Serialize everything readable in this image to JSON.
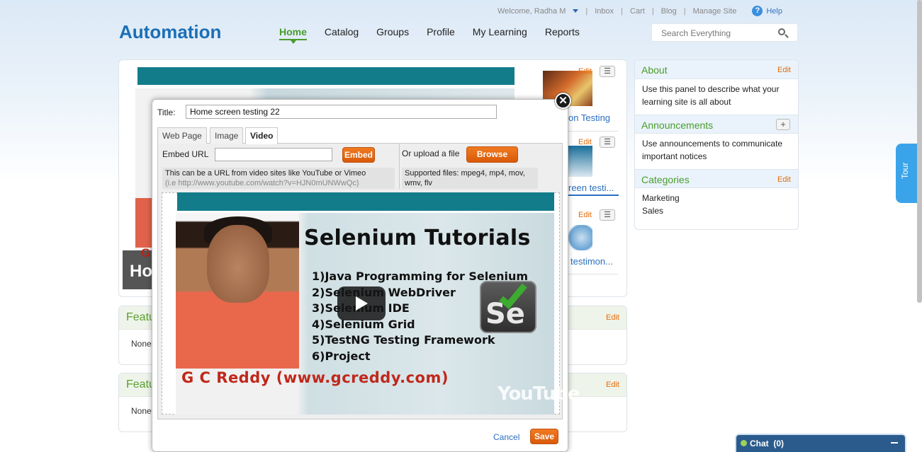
{
  "topbar": {
    "welcome": "Welcome, Radha M",
    "links": [
      "Inbox",
      "Cart",
      "Blog",
      "Manage Site"
    ],
    "help": "Help",
    "help_icon": "question-icon"
  },
  "brand": "Automation",
  "nav": {
    "items": [
      "Home",
      "Catalog",
      "Groups",
      "Profile",
      "My Learning",
      "Reports"
    ],
    "active": "Home"
  },
  "search": {
    "placeholder": "Search Everything",
    "icon": "magnifier-icon"
  },
  "hero": {
    "caption": "Ho",
    "caption_g": "G"
  },
  "side_items": [
    {
      "title": "on Testing",
      "edit": "Edit"
    },
    {
      "title": "reen testi...",
      "edit": "Edit"
    },
    {
      "title": "testimon...",
      "edit": "Edit"
    }
  ],
  "featured": [
    {
      "title": "Featu",
      "edit": "Edit",
      "value": "None"
    },
    {
      "title": "Featu",
      "edit": "Edit",
      "value": "None"
    }
  ],
  "right_panels": {
    "about": {
      "title": "About",
      "edit": "Edit",
      "body": "Use this panel to describe what your learning site is all about"
    },
    "announcements": {
      "title": "Announcements",
      "add": "+",
      "body": "Use announcements to communicate important notices"
    },
    "categories": {
      "title": "Categories",
      "edit": "Edit",
      "items": [
        "Marketing",
        "Sales"
      ]
    }
  },
  "tour": "Tour",
  "chat": {
    "label": "Chat",
    "count": "(0)"
  },
  "modal": {
    "title_label": "Title:",
    "title_value": "Home screen testing 22",
    "tabs": [
      "Web Page",
      "Image",
      "Video"
    ],
    "active_tab": "Video",
    "embed_label": "Embed URL",
    "embed_value": "",
    "embed_button": "Embed",
    "upload_label": "Or upload a file",
    "browse_button": "Browse",
    "embed_hint": "This can be a URL from video sites like YouTube or Vimeo",
    "embed_hint_example": "(i.e http://www.youtube.com/watch?v=HJN0mUNWwQc)",
    "supported_files": "Supported files: mpeg4, mp4, mov, wmv, flv",
    "cancel": "Cancel",
    "save": "Save",
    "close_icon": "close-icon"
  },
  "video": {
    "heading": "Selenium Tutorials",
    "list": [
      "1)Java Programming for Selenium",
      "2)Selenium WebDriver",
      "3)Selenium IDE",
      "4)Selenium Grid",
      "5)TestNG Testing Framework",
      "6)Project"
    ],
    "logo_text": "Se",
    "footer": "G C Reddy (www.gcreddy.com)",
    "watermark": "YouTube"
  },
  "colors": {
    "brand": "#1b6fb6",
    "nav_active": "#4a9c2b",
    "orange": "#e46c0a",
    "teal": "#127c8a",
    "link": "#2a70c0"
  }
}
